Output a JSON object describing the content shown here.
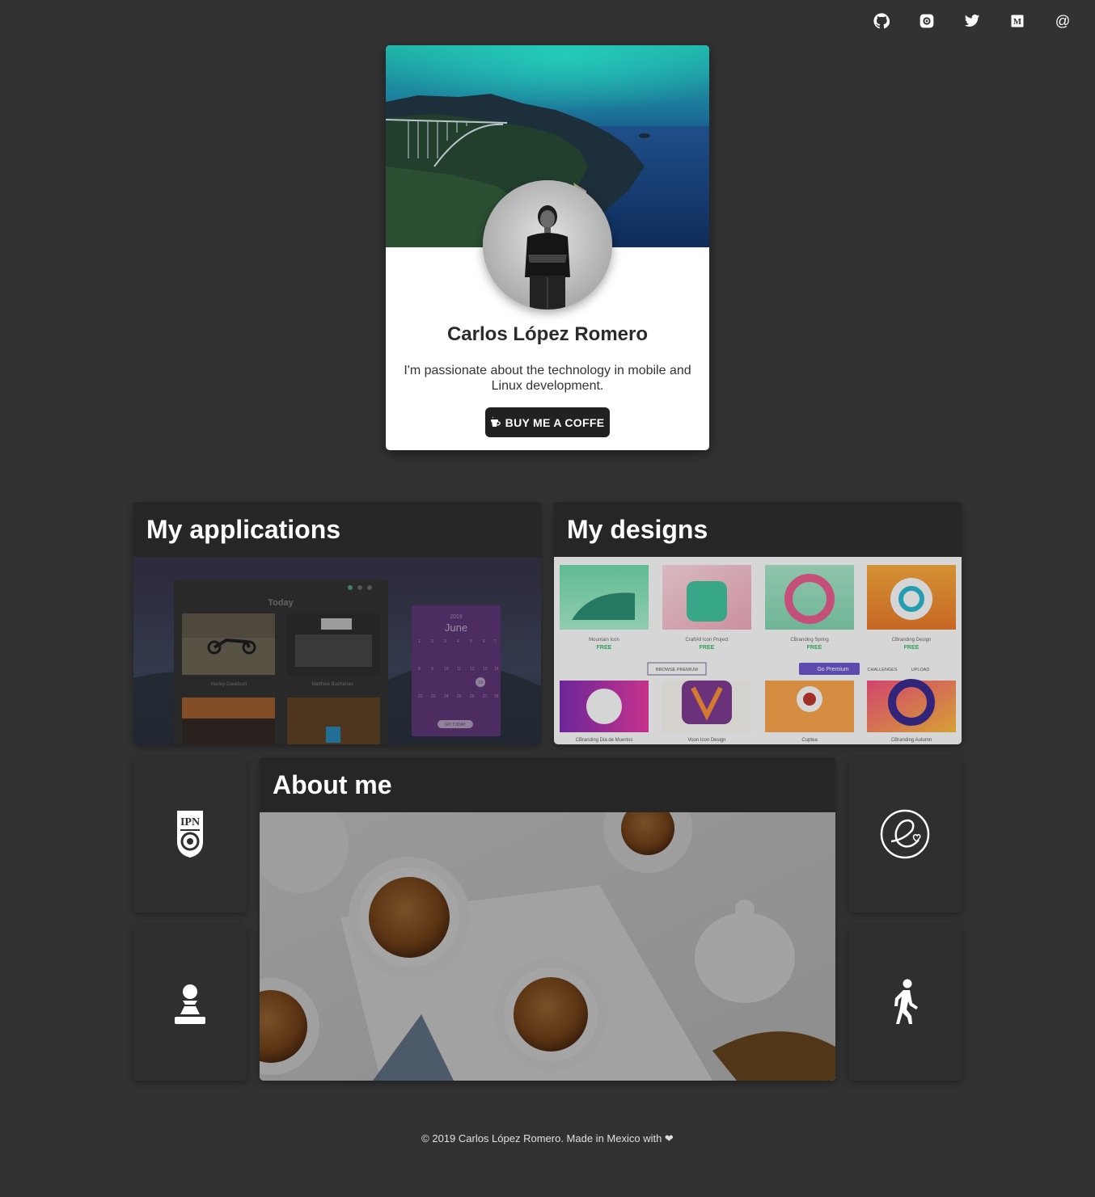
{
  "social": {
    "items": [
      {
        "icon": "github-icon"
      },
      {
        "icon": "dribbble-icon"
      },
      {
        "icon": "twitter-icon"
      },
      {
        "icon": "medium-icon"
      },
      {
        "icon": "email-icon"
      }
    ]
  },
  "profile": {
    "name": "Carlos López Romero",
    "bio": "I'm passionate about the technology in mobile and Linux development.",
    "coffee_button": "BUY ME A COFFE"
  },
  "tiles": {
    "applications": {
      "title": "My applications",
      "preview": {
        "heading": "Today",
        "items": [
          "Harley-Davidson",
          "Matthew Buchanan"
        ],
        "calendar": {
          "month": "June",
          "year": "2019",
          "highlight": "19",
          "button": "GO TODAY"
        }
      }
    },
    "designs": {
      "title": "My designs",
      "preview": {
        "top_row": [
          {
            "label": "Mountain Icon",
            "price": "FREE"
          },
          {
            "label": "CraftAll Icon Project",
            "price": "FREE"
          },
          {
            "label": "CBranding Spring",
            "price": "FREE"
          },
          {
            "label": "CBranding Design",
            "price": "FREE"
          }
        ],
        "toolbar": {
          "browse": "BROWSE PREMIUM",
          "premium": "Go Premium",
          "challenges": "CHALLENGES",
          "upload": "UPLOAD"
        },
        "bottom_row": [
          "CBranding Dia de Muertos",
          "Voon Icon Design",
          "Cuptea",
          "CBranding Autumn"
        ]
      }
    },
    "about": {
      "title": "About me"
    }
  },
  "side_tiles": [
    {
      "icon": "ipn-logo-icon"
    },
    {
      "icon": "chess-pawn-icon"
    },
    {
      "icon": "elementary-os-icon"
    },
    {
      "icon": "walking-person-icon"
    }
  ],
  "footer": {
    "text": "© 2019 Carlos López Romero. Made in Mexico with ❤"
  },
  "colors": {
    "background": "#323232",
    "tile": "#2f2f2f",
    "tile_header": "#262626",
    "card": "#ffffff",
    "button": "#212121"
  }
}
